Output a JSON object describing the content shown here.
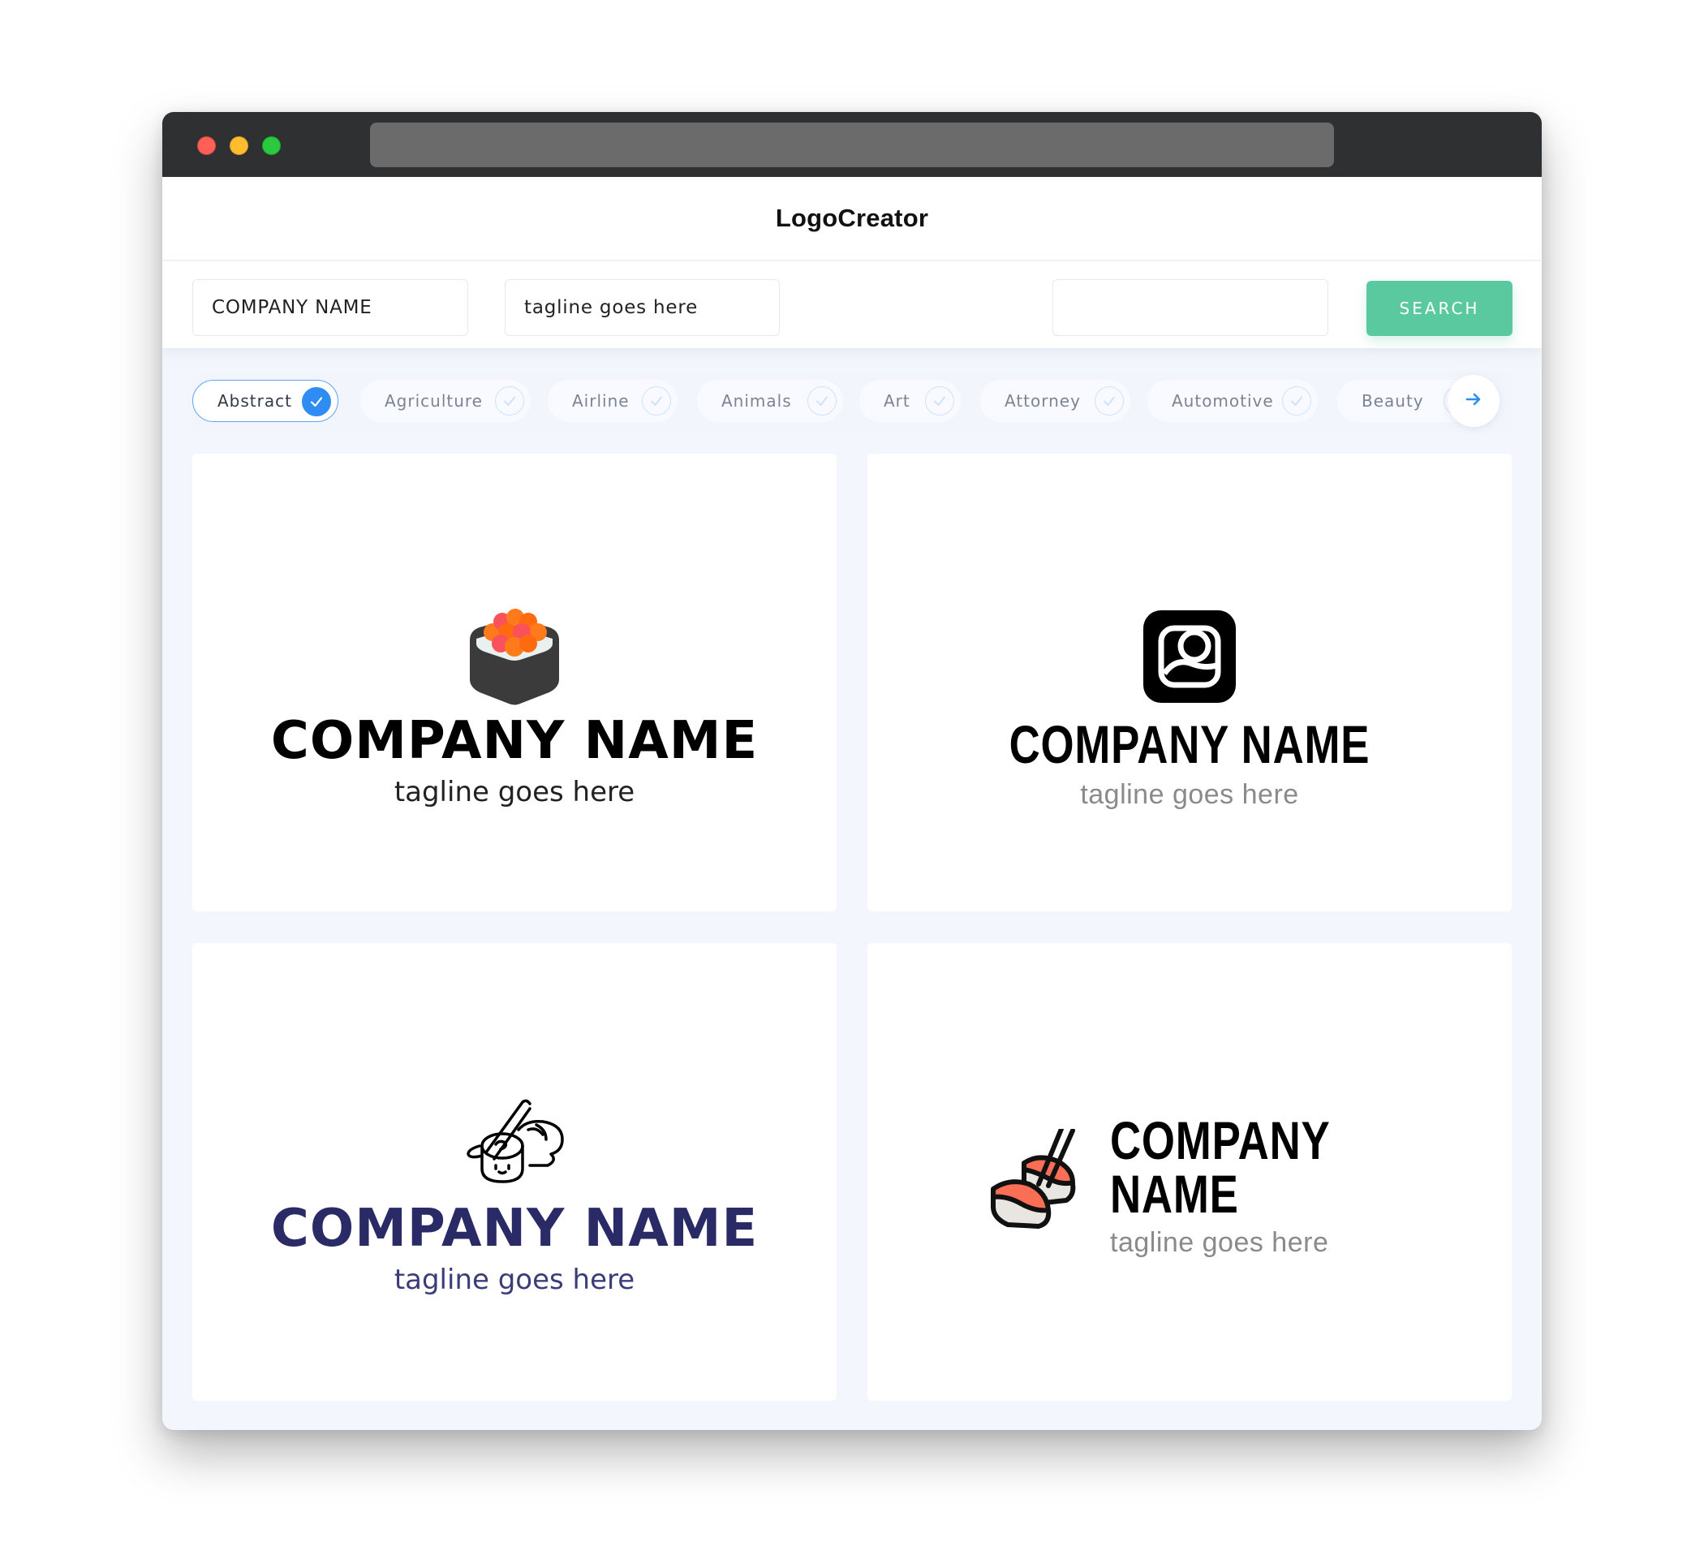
{
  "window": {
    "controls": [
      "close",
      "minimize",
      "maximize"
    ],
    "url": ""
  },
  "header": {
    "title": "LogoCreator"
  },
  "search": {
    "company_value": "COMPANY NAME",
    "tagline_value": "tagline goes here",
    "keyword_value": "",
    "button_label": "SEARCH"
  },
  "categories": {
    "items": [
      {
        "label": "Abstract",
        "selected": true
      },
      {
        "label": "Agriculture",
        "selected": false
      },
      {
        "label": "Airline",
        "selected": false
      },
      {
        "label": "Animals",
        "selected": false
      },
      {
        "label": "Art",
        "selected": false
      },
      {
        "label": "Attorney",
        "selected": false
      },
      {
        "label": "Automotive",
        "selected": false
      },
      {
        "label": "Beauty",
        "selected": false
      }
    ],
    "next_icon": "arrow-right-icon"
  },
  "logos": [
    {
      "icon": "sushi-roll-roe-icon",
      "company": "COMPANY NAME",
      "tagline": "tagline goes here",
      "name_color": "#000000",
      "tagline_color": "#222222"
    },
    {
      "icon": "rounded-square-face-icon",
      "company": "COMPANY NAME",
      "tagline": "tagline goes here",
      "name_color": "#000000",
      "tagline_color": "#8a8a8a"
    },
    {
      "icon": "sushi-chopsticks-outline-icon",
      "company": "COMPANY NAME",
      "tagline": "tagline goes here",
      "name_color": "#2a2a66",
      "tagline_color": "#3c3c78"
    },
    {
      "icon": "salmon-nigiri-chopsticks-icon",
      "company": "COMPANY NAME",
      "tagline": "tagline goes here",
      "name_color": "#000000",
      "tagline_color": "#8a8a8a"
    }
  ],
  "colors": {
    "accent_blue": "#2e8cf3",
    "search_green": "#5bc9a0",
    "titlebar": "#2f3032"
  }
}
